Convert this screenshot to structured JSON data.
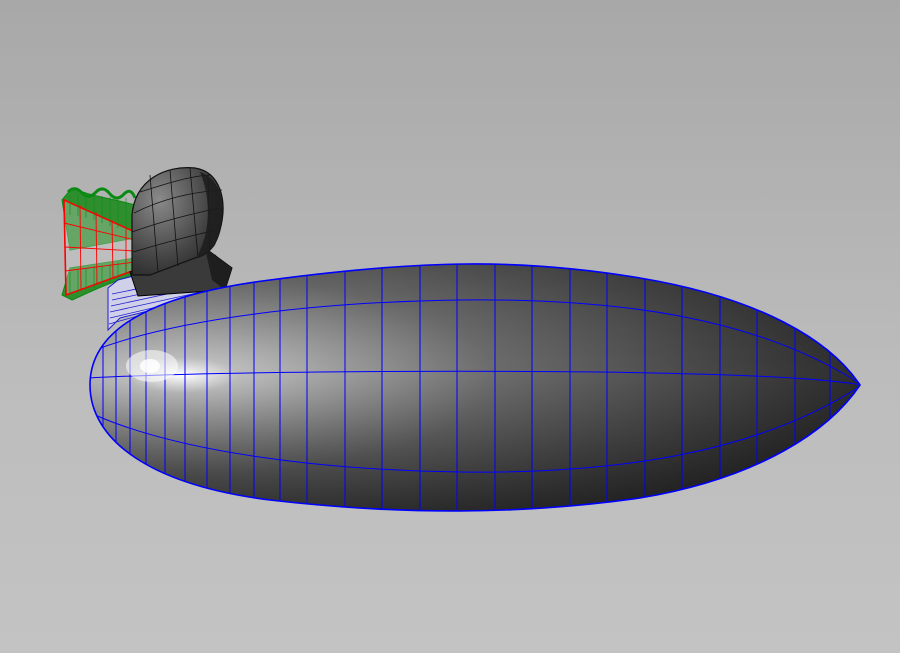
{
  "viewport": {
    "background_top": "#a7a7a7",
    "background_bottom": "#c6c6c6"
  },
  "colors": {
    "hull_light": "#d8d8d8",
    "hull_mid": "#707070",
    "hull_dark": "#2a2a2a",
    "wireframe_hull": "#0000ff",
    "wireframe_fan": "#ff0000",
    "wireframe_bellows": "#0a8a12",
    "wireframe_seat": "#1a1a1a",
    "wireframe_mount": "#0000ff"
  },
  "objects": {
    "hull": "hull-mesh",
    "cowl": "engine-cowl-mesh",
    "fan": "propeller-fan-mesh",
    "bellows": "bellows-mesh",
    "mount": "engine-mount-mesh"
  }
}
